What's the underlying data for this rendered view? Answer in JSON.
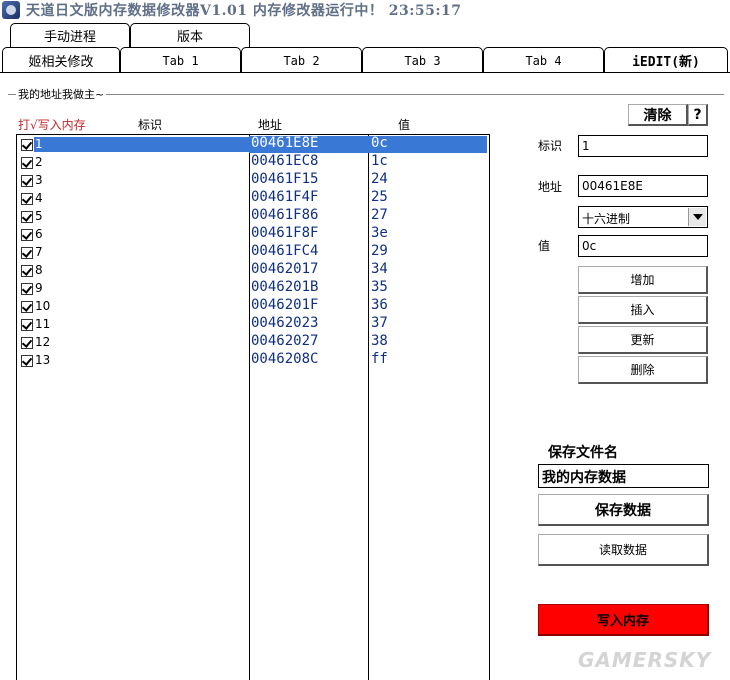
{
  "window": {
    "title": "天道日文版内存数据修改器V1.01 内存修改器运行中！ 23:55:17"
  },
  "tabs_top": [
    {
      "label": "手动进程"
    },
    {
      "label": "版本"
    }
  ],
  "tabs_bottom": [
    {
      "label": "姬相关修改"
    },
    {
      "label": "Tab 1"
    },
    {
      "label": "Tab 2"
    },
    {
      "label": "Tab 3"
    },
    {
      "label": "Tab 4"
    },
    {
      "label": "iEDIT(新)",
      "active": true
    }
  ],
  "group": {
    "caption": "我的地址我做主~"
  },
  "columns": {
    "write": "打√写入内存",
    "id": "标识",
    "address": "地址",
    "value": "值"
  },
  "rows": [
    {
      "id": "1",
      "address": "00461E8E",
      "value": "0c",
      "checked": true,
      "selected": true
    },
    {
      "id": "2",
      "address": "00461EC8",
      "value": "1c",
      "checked": true
    },
    {
      "id": "3",
      "address": "00461F15",
      "value": "24",
      "checked": true
    },
    {
      "id": "4",
      "address": "00461F4F",
      "value": "25",
      "checked": true
    },
    {
      "id": "5",
      "address": "00461F86",
      "value": "27",
      "checked": true
    },
    {
      "id": "6",
      "address": "00461F8F",
      "value": "3e",
      "checked": true
    },
    {
      "id": "7",
      "address": "00461FC4",
      "value": "29",
      "checked": true
    },
    {
      "id": "8",
      "address": "00462017",
      "value": "34",
      "checked": true
    },
    {
      "id": "9",
      "address": "0046201B",
      "value": "35",
      "checked": true
    },
    {
      "id": "10",
      "address": "0046201F",
      "value": "36",
      "checked": true
    },
    {
      "id": "11",
      "address": "00462023",
      "value": "37",
      "checked": true
    },
    {
      "id": "12",
      "address": "00462027",
      "value": "38",
      "checked": true
    },
    {
      "id": "13",
      "address": "0046208C",
      "value": "ff",
      "checked": true
    }
  ],
  "side": {
    "clear_label": "清除",
    "help_label": "?",
    "id_label": "标识",
    "id_value": "1",
    "address_label": "地址",
    "address_value": "00461E8E",
    "format_selected": "十六进制",
    "value_label": "值",
    "value_value": "0c",
    "add_label": "增加",
    "insert_label": "插入",
    "update_label": "更新",
    "delete_label": "删除",
    "save_name_label": "保存文件名",
    "save_name_value": "我的内存数据",
    "save_data_label": "保存数据",
    "load_data_label": "读取数据",
    "write_memory_label": "写入内存"
  },
  "watermark": {
    "text": "GAMERSKY"
  },
  "colors": {
    "selection": "#3a78d6",
    "address_text": "#0f2f80",
    "header_red": "#c0282d",
    "write_button": "#ff0000"
  }
}
